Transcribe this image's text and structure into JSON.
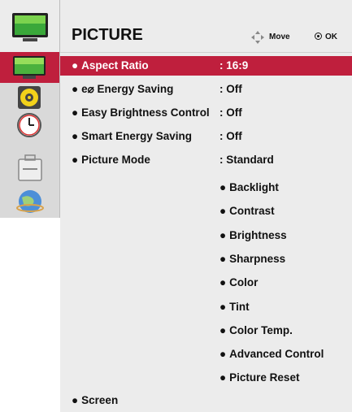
{
  "header": {
    "title": "PICTURE",
    "move_label": "Move",
    "ok_label": "OK"
  },
  "sidebar": {
    "items": [
      {
        "name": "picture-icon",
        "active": true
      },
      {
        "name": "audio-icon",
        "active": false
      },
      {
        "name": "time-icon",
        "active": false
      },
      {
        "name": "option-icon",
        "active": false
      },
      {
        "name": "network-icon",
        "active": false
      }
    ]
  },
  "menu": {
    "items": [
      {
        "label": "Aspect Ratio",
        "value": ": 16:9",
        "selected": true
      },
      {
        "label": "e⌀ Energy Saving",
        "value": ": Off",
        "selected": false
      },
      {
        "label": "Easy Brightness Control",
        "value": ": Off",
        "selected": false
      },
      {
        "label": "Smart Energy Saving",
        "value": ": Off",
        "selected": false
      },
      {
        "label": "Picture Mode",
        "value": ": Standard",
        "selected": false
      }
    ],
    "picture_mode_sub": [
      "Backlight",
      "Contrast",
      "Brightness",
      "Sharpness",
      "Color",
      "Tint",
      "Color Temp.",
      "Advanced Control",
      "Picture Reset"
    ],
    "screen_label": "Screen"
  },
  "colors": {
    "accent": "#bf1f3d",
    "panel": "#ececec",
    "sidebar": "#d9d9d9"
  }
}
